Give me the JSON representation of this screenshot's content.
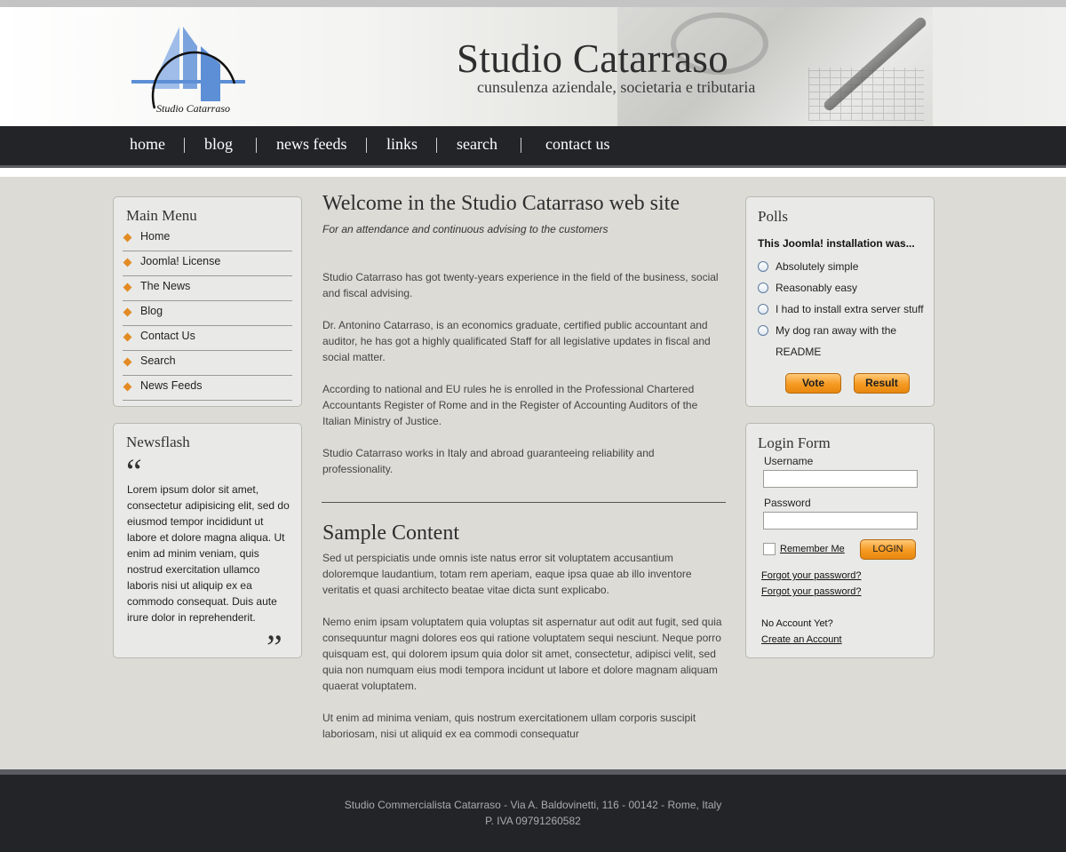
{
  "site": {
    "title": "Studio Catarraso",
    "subtitle": "cunsulenza aziendale, societaria e tributaria",
    "logo_text": "Studio Catarraso"
  },
  "nav": {
    "items": [
      "home",
      "blog",
      "news feeds",
      "links",
      "search",
      "contact us"
    ]
  },
  "main_menu": {
    "title": "Main Menu",
    "items": [
      "Home",
      "Joomla! License",
      "The News",
      "Blog",
      "Contact Us",
      "Search",
      "News Feeds"
    ]
  },
  "newsflash": {
    "title": "Newsflash",
    "open_quote": "“",
    "close_quote": "”",
    "text": "Lorem ipsum dolor sit amet, consectetur adipisicing elit, sed do eiusmod tempor incididunt ut labore et dolore magna aliqua. Ut enim ad minim veniam, quis nostrud exercitation ullamco laboris nisi ut aliquip ex ea commodo consequat. Duis aute irure dolor in reprehenderit."
  },
  "main": {
    "title": "Welcome in the Studio Catarraso web site",
    "tagline": "For an attendance and continuous advising to the customers",
    "paragraphs": [
      "Studio Catarraso has got twenty-years experience in the field of the business, social and fiscal advising.",
      "Dr. Antonino Catarraso, is an economics graduate, certified public accountant and auditor, he has got a highly qualificated Staff for all legislative updates in fiscal and social matter.",
      "According to national and EU rules he is enrolled in the Professional Chartered Accountants Register of Rome and in the Register of Accounting Auditors of the Italian Ministry of Justice.",
      "Studio Catarraso works in Italy and abroad guaranteeing reliability and professionality."
    ],
    "section_title": "Sample Content",
    "sample_paragraphs": [
      "Sed ut perspiciatis unde omnis iste natus error sit voluptatem accusantium doloremque laudantium, totam rem aperiam, eaque ipsa quae ab illo inventore veritatis et quasi architecto beatae vitae dicta sunt explicabo.",
      "Nemo enim ipsam voluptatem quia voluptas sit aspernatur aut odit aut fugit, sed quia consequuntur magni dolores eos qui ratione voluptatem sequi nesciunt. Neque porro quisquam est, qui dolorem ipsum quia dolor sit amet, consectetur, adipisci velit, sed quia non numquam eius modi tempora incidunt ut labore et dolore magnam aliquam quaerat voluptatem.",
      "Ut enim ad minima veniam, quis nostrum exercitationem ullam corporis suscipit laboriosam, nisi ut aliquid ex ea commodi consequatur"
    ]
  },
  "polls": {
    "title": "Polls",
    "question": "This Joomla! installation was...",
    "options": [
      "Absolutely simple",
      "Reasonably easy",
      "I had to install extra server stuff",
      "My dog ran away with the README"
    ],
    "vote_label": "Vote",
    "result_label": "Result"
  },
  "login": {
    "title": "Login Form",
    "username_label": "Username",
    "username_value": "",
    "password_label": "Password",
    "password_value": "",
    "remember_label": "Remember Me",
    "login_label": "LOGIN",
    "forgot_password_1": "Forgot your password?",
    "forgot_password_2": "Forgot your password?",
    "no_account": "No Account Yet?",
    "create_account": "Create an Account"
  },
  "footer": {
    "line1": "Studio Commercialista Catarraso - Via A. Baldovinetti, 116 - 00142 - Rome, Italy",
    "line2": "P. IVA 09791260582"
  },
  "colors": {
    "navbar": "#222428",
    "accent_orange": "#f59a21",
    "background": "#dcdbd6"
  }
}
